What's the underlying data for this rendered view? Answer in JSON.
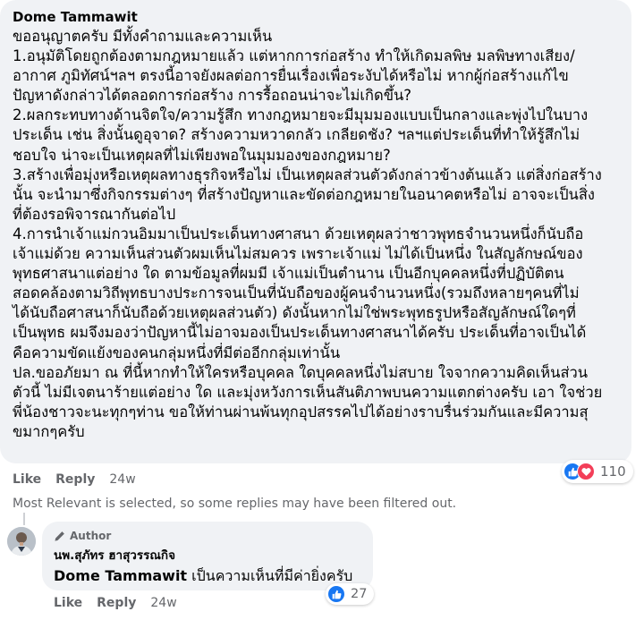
{
  "comment": {
    "author": "Dome Tammawit",
    "paragraphs": [
      "ขออนุญาตครับ มีทั้งคำถามและความเห็น",
      "1.อนุมัติโดยถูกต้องตามกฎหมายแล้ว แต่หากการก่อสร้าง ทำให้เกิดมลพิษ มลพิษทางเสียง/\nอากาศ ภูมิทัศน์ฯลฯ ตรงนี้อาจยังผลต่อการยื่นเรื่องเพื่อระงับได้หรือไม่ หากผู้ก่อสร้างแก้ไข\nปัญหาดังกล่าวได้ตลอดการก่อสร้าง การรื้อถอนน่าจะไม่เกิดขึ้น?",
      "2.ผลกระทบทางด้านจิตใจ/ความรู้สึก ทางกฎหมายจะมีมุมมองแบบเป็นกลางและพุ่งไปในบาง\nประเด็น เช่น สิ่งนั้นดูอุจาด? สร้างความหวาดกลัว เกลียดชัง? ฯลฯแต่ประเด็นที่ทำให้รู้สึกไม่\nชอบใจ น่าจะเป็นเหตุผลที่ไม่เพียงพอในมุมมองของกฎหมาย?",
      "3.สร้างเพื่อมุ่งหรือเหตุผลทางธุรกิจหรือไม่ เป็นเหตุผลส่วนตัวดังกล่าวข้างต้นแล้ว แต่สิ่งก่อสร้าง\nนั้น จะนำมาซึ่งกิจกรรมต่างๆ ที่สร้างปัญหาและขัดต่อกฎหมายในอนาคตหรือไม่ อาจจะเป็นสิ่ง\nที่ต้องรอพิจารณากันต่อไป",
      "4.การนำเจ้าแม่กวนอิมมาเป็นประเด็นทางศาสนา ด้วยเหตุผลว่าชาวพุทธจำนวนหนึ่งก็นับถือ\nเจ้าแม่ด้วย ความเห็นส่วนตัวผมเห็นไม่สมควร เพราะเจ้าแม่ ไม่ได้เป็นหนึ่ง ในสัญลักษณ์ของ\nพุทธศาสนาแต่อย่าง ใด ตามข้อมูลที่ผมมี เจ้าแม่เป็นตำนาน เป็นอีกบุคคลหนึ่งที่ปฏิบัติตน\nสอดคล้องตามวิถีพุทธบางประการจนเป็นที่นับถือของผู้คนจำนวนหนึ่ง(รวมถึงหลายๆคนที่ไม่\nได้นับถือศาสนาก็นับถือด้วยเหตุผลส่วนตัว) ดังนั้นหากไม่ใช่พระพุทธรูปหรือสัญลักษณ์ใดๆที่\nเป็นพุทธ ผมจึงมองว่าปัญหานี้ไม่อาจมองเป็นประเด็นทางศาสนาได้ครับ ประเด็นที่อาจเป็นได้\nคือความขัดแย้งของคนกลุ่มหนึ่งที่มีต่ออีกกลุ่มเท่านั้น",
      "ปล.ขออภัยมา ณ ที่นี้หากทำให้ใครหรือบุคคล ใดบุคคลหนึ่งไม่สบาย ใจจากความคิดเห็นส่วน\nตัวนี้ ไม่มีเจตนาร้ายแต่อย่าง ใด และมุ่งหวังการเห็นสันติภาพบนความแตกต่างครับ เอา ใจช่วย\nพี่น้องชาวจะนะทุกๆท่าน ขอให้ท่านผ่านพ้นทุกอุปสรรคไปได้อย่างราบรื่นร่วมกันและมีความสุ\nขมากๆครับ"
    ],
    "reaction_count": "110",
    "reaction_icons": [
      "like-icon",
      "love-icon"
    ],
    "actions": {
      "like": "Like",
      "reply": "Reply",
      "time": "24w"
    }
  },
  "filter_note": "Most Relevant is selected, so some replies may have been filtered out.",
  "reply": {
    "badge": "Author",
    "author": "นพ.สุภัทร ฮาสุวรรณกิจ",
    "mention": "Dome Tammawit",
    "text": " เป็นความเห็นที่มีค่ายิ่งครับ",
    "reaction_count": "27",
    "actions": {
      "like": "Like",
      "reply": "Reply",
      "time": "24w"
    }
  },
  "colors": {
    "bubble_bg": "#f0f2f5",
    "muted_text": "#65676b",
    "like_blue": "#1877f2",
    "love_red": "#f33e58"
  }
}
